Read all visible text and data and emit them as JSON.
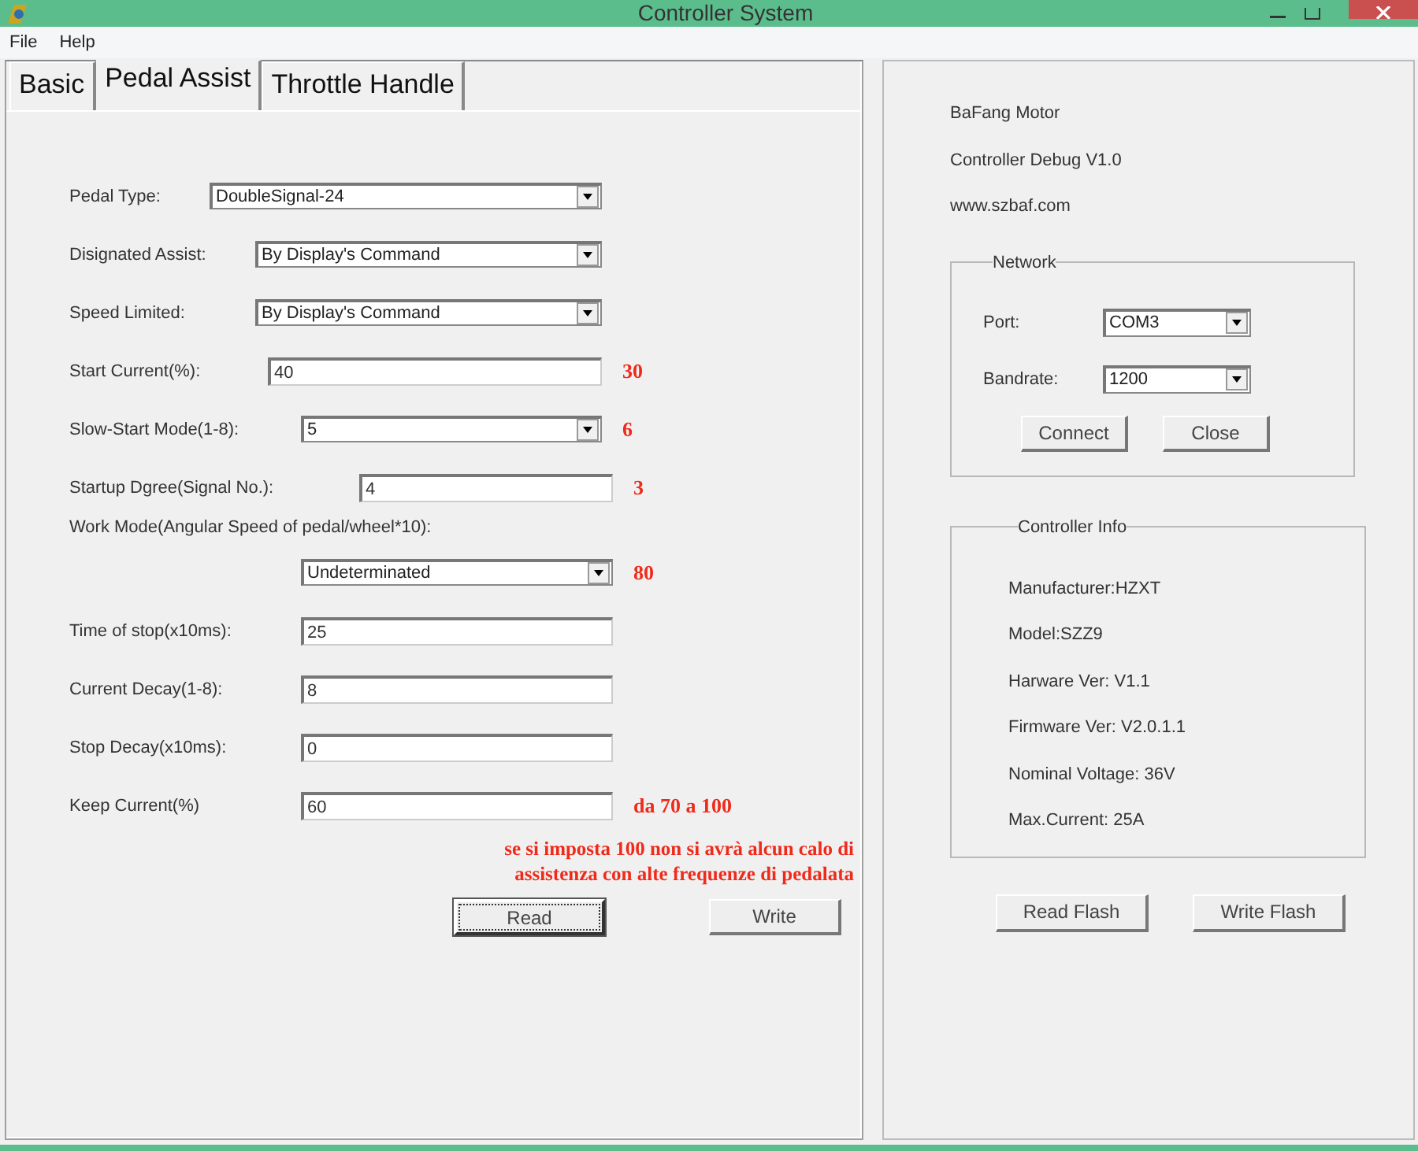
{
  "window": {
    "title": "Controller System"
  },
  "menu": [
    "File",
    "Help"
  ],
  "tabs": [
    {
      "label": "Basic",
      "selected": false
    },
    {
      "label": "Pedal Assist",
      "selected": true
    },
    {
      "label": "Throttle Handle",
      "selected": false
    }
  ],
  "fields": [
    {
      "label": "Pedal Type:",
      "kind": "select",
      "value": "DoubleSignal-24",
      "label_above": false
    },
    {
      "label": "Disignated Assist:",
      "kind": "select",
      "value": "By Display's Command",
      "label_above": false
    },
    {
      "label": "Speed Limited:",
      "kind": "select",
      "value": "By Display's Command",
      "label_above": false
    },
    {
      "label": "Start Current(%):",
      "kind": "text",
      "value": "40",
      "label_above": false,
      "annotation": "30"
    },
    {
      "label": "Slow-Start Mode(1-8):",
      "kind": "select",
      "value": "5",
      "label_above": false,
      "annotation": "6"
    },
    {
      "label": "Startup Dgree(Signal No.):",
      "kind": "text",
      "value": "4",
      "label_above": false,
      "annotation": "3"
    },
    {
      "label": "Work Mode(Angular Speed of pedal/wheel*10):",
      "kind": "select",
      "value": "Undeterminated",
      "label_above": true,
      "annotation": "80"
    },
    {
      "label": "Time of stop(x10ms):",
      "kind": "text",
      "value": "25",
      "label_above": false
    },
    {
      "label": "Current Decay(1-8):",
      "kind": "text",
      "value": "8",
      "label_above": false
    },
    {
      "label": "Stop Decay(x10ms):",
      "kind": "text",
      "value": "0",
      "label_above": false
    },
    {
      "label": "Keep Current(%)",
      "kind": "text",
      "value": "60",
      "label_above": false,
      "annotation": "da 70 a 100"
    }
  ],
  "note": "se si imposta 100 non si avrà alcun calo di assistenza con alte frequenze di pedalata",
  "buttons": [
    {
      "label": "Read",
      "focused": true
    },
    {
      "label": "Write",
      "focused": false
    }
  ],
  "info": [
    "BaFang Motor",
    "Controller Debug V1.0",
    "www.szbaf.com"
  ],
  "network": {
    "title": "Network",
    "port": {
      "label": "Port:",
      "value": "COM3"
    },
    "baudrate": {
      "label": "Bandrate:",
      "value": "1200"
    },
    "buttons": [
      "Connect",
      "Close"
    ]
  },
  "controller_info": {
    "title": "Controller Info",
    "lines": [
      "Manufacturer:HZXT",
      "Model:SZZ9",
      "Harware Ver: V1.1",
      "Firmware Ver: V2.0.1.1",
      "Nominal Voltage: 36V",
      "Max.Current: 25A"
    ]
  },
  "flash_buttons": [
    "Read Flash",
    "Write Flash"
  ]
}
